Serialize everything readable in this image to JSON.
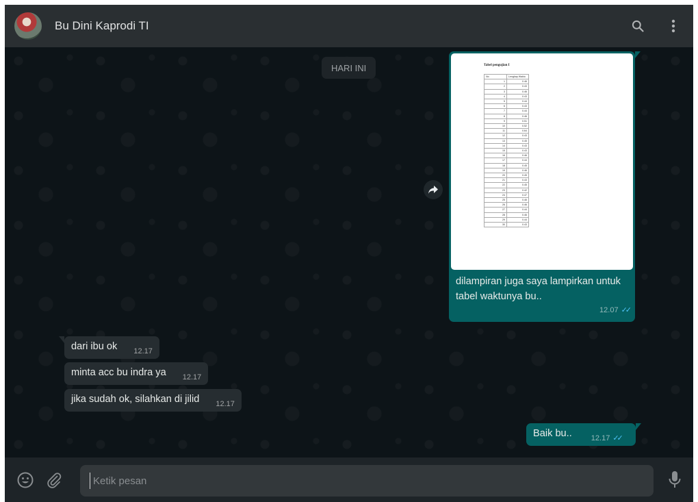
{
  "header": {
    "contact_name": "Bu Dini Kaprodi TI",
    "icons": [
      "avatar",
      "search-icon",
      "menu-dots-icon"
    ]
  },
  "chat": {
    "day_separator": "HARI INI",
    "image_message": {
      "direction": "outgoing",
      "document_title": "Tabel pengujian I",
      "table_headers": [
        "No",
        "Lengkap Waktu"
      ],
      "table_rows": [
        [
          "1",
          "0.46"
        ],
        [
          "2",
          "0.43"
        ],
        [
          "3",
          "0.46"
        ],
        [
          "4",
          "0.43"
        ],
        [
          "5",
          "0.44"
        ],
        [
          "6",
          "0.43"
        ],
        [
          "7",
          "0.44"
        ],
        [
          "8",
          "0.46"
        ],
        [
          "9",
          "0.51"
        ],
        [
          "10",
          "0.52"
        ],
        [
          "11",
          "0.64"
        ],
        [
          "12",
          "0.43"
        ],
        [
          "13",
          "0.45"
        ],
        [
          "14",
          "0.43"
        ],
        [
          "15",
          "0.43"
        ],
        [
          "16",
          "0.46"
        ],
        [
          "17",
          "0.44"
        ],
        [
          "18",
          "0.45"
        ],
        [
          "19",
          "0.46"
        ],
        [
          "20",
          "0.45"
        ],
        [
          "21",
          "0.43"
        ],
        [
          "22",
          "0.45"
        ],
        [
          "23",
          "0.42"
        ],
        [
          "24",
          "0.47"
        ],
        [
          "25",
          "0.46"
        ],
        [
          "26",
          "0.46"
        ],
        [
          "27",
          "0.44"
        ],
        [
          "28",
          "0.46"
        ],
        [
          "29",
          "0.44"
        ],
        [
          "30",
          "0.43"
        ]
      ],
      "caption": "dilampiran juga saya lampirkan untuk tabel waktunya bu..",
      "time": "12.07"
    },
    "incoming": [
      {
        "text": "dari ibu ok",
        "time": "12.17"
      },
      {
        "text": "minta acc bu indra ya",
        "time": "12.17"
      },
      {
        "text": "jika sudah ok, silahkan di jilid",
        "time": "12.17"
      }
    ],
    "outgoing_last": {
      "text": "Baik bu..",
      "time": "12.17"
    },
    "colors": {
      "outgoing_bubble": "#056162",
      "incoming_bubble": "#262d31",
      "read_ticks": "#4fc3f7"
    }
  },
  "footer": {
    "placeholder": "Ketik pesan",
    "icons": [
      "emoji-icon",
      "attach-icon",
      "microphone-icon"
    ]
  }
}
